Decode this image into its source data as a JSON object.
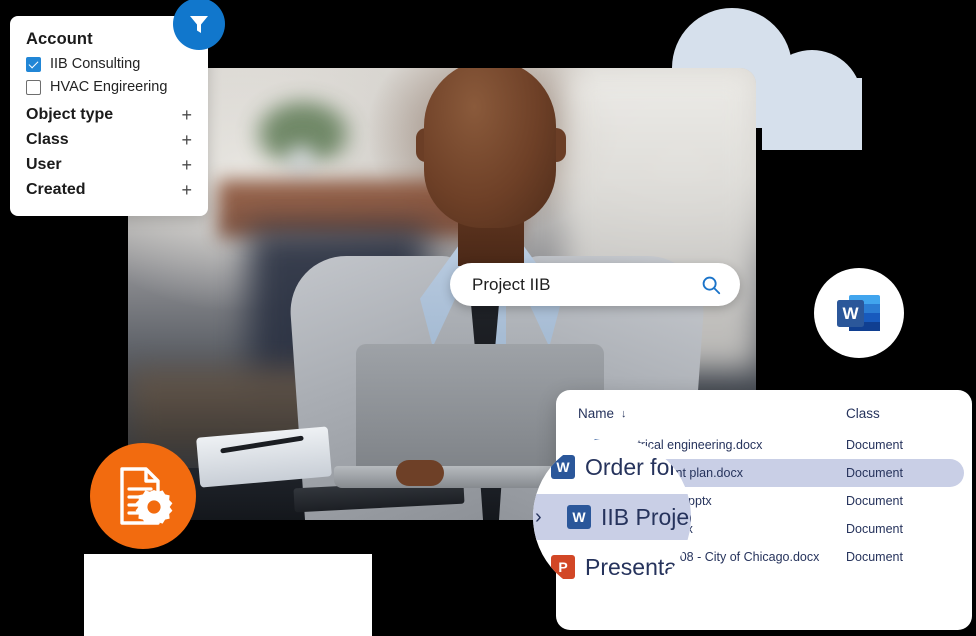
{
  "filter_panel": {
    "title": "Account",
    "checkboxes": [
      {
        "label": "IIB Consulting",
        "checked": true
      },
      {
        "label": "HVAC Engireering",
        "checked": false
      }
    ],
    "facets": [
      {
        "label": "Object type",
        "expander": "+"
      },
      {
        "label": "Class",
        "expander": "+"
      },
      {
        "label": "User",
        "expander": "+"
      },
      {
        "label": "Created",
        "expander": "+"
      }
    ]
  },
  "badges": {
    "funnel_icon": "filter-funnel-icon",
    "word_icon": "microsoft-word-icon",
    "document_settings_icon": "document-gear-icon",
    "funnel_color": "#1177cc",
    "document_badge_color": "#f26b0f",
    "word_blue": "#2b579a"
  },
  "search": {
    "value": "Project IIB",
    "placeholder": "Search",
    "icon": "search-icon",
    "icon_color": "#1a73c9"
  },
  "results": {
    "columns": {
      "name": "Name",
      "class": "Class"
    },
    "sort_indicator": "↓",
    "rows": [
      {
        "chevron": "",
        "icon": "word",
        "name": "Electrical engineering.docx",
        "class": "Document",
        "selected": false
      },
      {
        "chevron": "",
        "icon": "word",
        "name": "management plan.docx",
        "class": "Document",
        "selected": true
      },
      {
        "chevron": "",
        "icon": "powerpoint",
        "name": "tion template.pptx",
        "class": "Document",
        "selected": false
      },
      {
        "chevron": "",
        "icon": "powerpoint",
        "name": "map draft.pptx",
        "class": "Document",
        "selected": false
      },
      {
        "chevron": "›",
        "icon": "word",
        "name": "Proposal 7708 - City of Chicago.docx",
        "class": "Document",
        "selected": false
      }
    ]
  },
  "magnifier": {
    "rows": [
      {
        "chevron": "",
        "icon": "word",
        "name": "Order for"
      },
      {
        "chevron": "›",
        "icon": "word",
        "name": "IIB Project"
      },
      {
        "chevron": "",
        "icon": "powerpoint",
        "name": "Presentat"
      }
    ],
    "selected_index": 1,
    "selected_bg": "#c9cfe6"
  },
  "colors": {
    "background": "#000000",
    "cloud": "#d6e0ec",
    "text_navy": "#26335c",
    "panel_white": "#ffffff"
  }
}
